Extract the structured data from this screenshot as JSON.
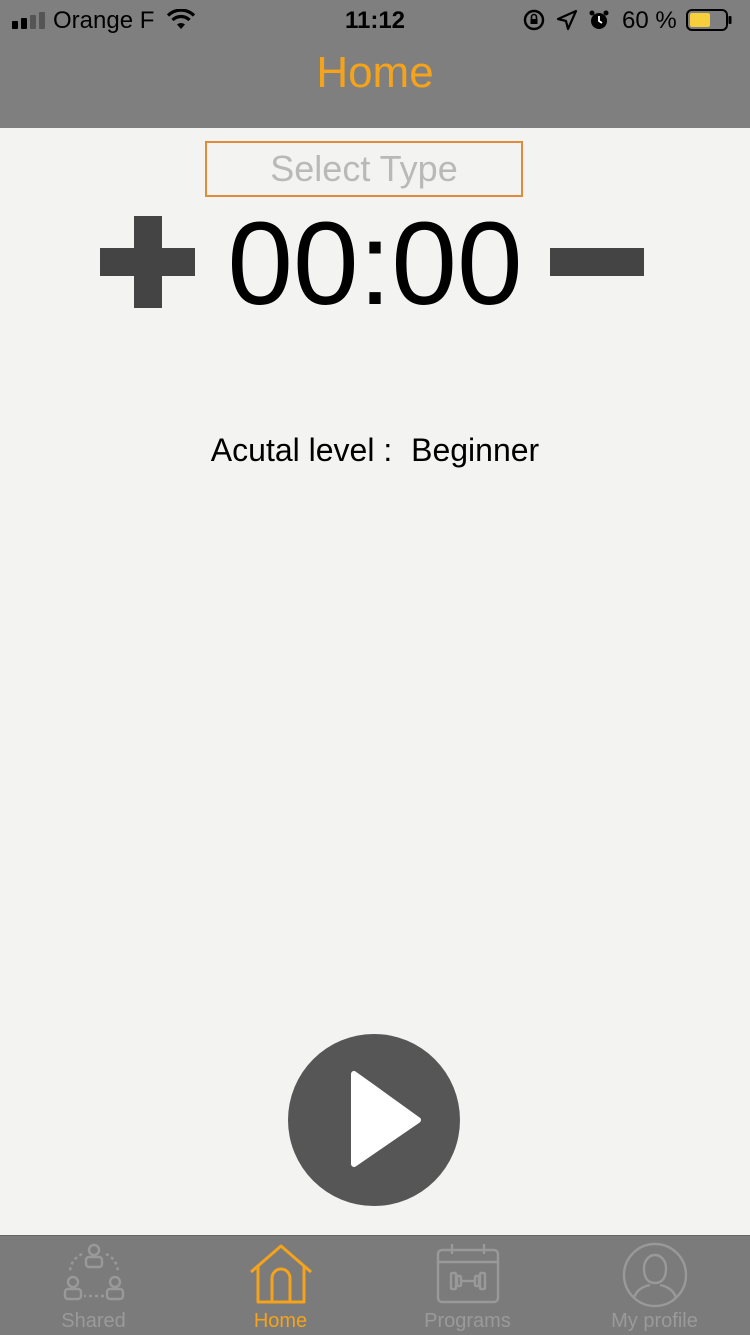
{
  "status_bar": {
    "carrier": "Orange F",
    "time": "11:12",
    "battery_percent": "60 %",
    "battery_level": 0.6,
    "signal_bars_active": 2,
    "signal_bars_total": 4,
    "icons": [
      "wifi-icon",
      "rotation-lock-icon",
      "location-icon",
      "alarm-icon",
      "battery-icon"
    ]
  },
  "nav": {
    "title": "Home"
  },
  "select_type": {
    "placeholder": "Select Type"
  },
  "timer": {
    "value": "00:00",
    "increment_icon": "plus-icon",
    "decrement_icon": "minus-icon"
  },
  "level": {
    "label": "Acutal level :",
    "value": "Beginner"
  },
  "play_button": {
    "icon": "play-icon"
  },
  "tabs": [
    {
      "label": "Shared",
      "icon": "shared-icon",
      "active": false
    },
    {
      "label": "Home",
      "icon": "home-icon",
      "active": true
    },
    {
      "label": "Programs",
      "icon": "calendar-dumbbell-icon",
      "active": false
    },
    {
      "label": "My profile",
      "icon": "profile-icon",
      "active": false
    }
  ],
  "colors": {
    "accent": "#f5a31a",
    "bar_background": "#7f7f7f",
    "page_background": "#f3f3f2",
    "control_dark": "#444444",
    "select_border": "#e08a3a"
  }
}
